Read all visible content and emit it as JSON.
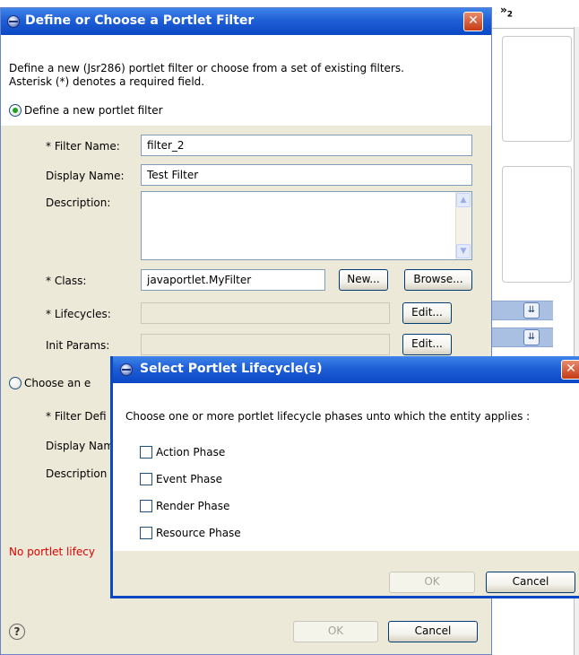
{
  "background": {
    "chevron": "»",
    "chevron_sub": "2",
    "bar_icons": [
      "double-chevron-down-icon",
      "double-chevron-down-icon"
    ]
  },
  "main_dialog": {
    "title": "Define or Choose a Portlet Filter",
    "close_symbol": "✕",
    "description_line1": "Define a new (Jsr286) portlet filter or choose from a set of existing filters.",
    "description_line2": "Asterisk (*) denotes a required field.",
    "define_radio_label": "Define a new portlet filter",
    "fields": {
      "filter_name_label": "* Filter Name:",
      "filter_name_value": "filter_2",
      "display_name_label": "Display Name:",
      "display_name_value": "Test Filter",
      "description_label": "Description:",
      "description_value": "",
      "class_label": "* Class:",
      "class_value": "javaportlet.MyFilter",
      "new_button": "New...",
      "browse_button": "Browse...",
      "lifecycles_label": "* Lifecycles:",
      "lifecycles_value": "",
      "edit_button": "Edit...",
      "init_params_label": "Init Params:",
      "init_params_value": ""
    },
    "choose_radio_label": "Choose an e",
    "existing": {
      "filter_def_label": "* Filter Defi",
      "display_name_label": "Display Nam",
      "description_label": "Description"
    },
    "error_text": "No portlet lifecy",
    "help_symbol": "?",
    "ok_button": "OK",
    "cancel_button": "Cancel"
  },
  "lifecycle_dialog": {
    "title": "Select Portlet Lifecycle(s)",
    "close_symbol": "✕",
    "instruction": "Choose one or more portlet lifecycle phases unto which the entity applies :",
    "phases": [
      {
        "label": "Action Phase",
        "checked": false
      },
      {
        "label": "Event Phase",
        "checked": false
      },
      {
        "label": "Render Phase",
        "checked": false
      },
      {
        "label": "Resource Phase",
        "checked": false
      }
    ],
    "ok_button": "OK",
    "cancel_button": "Cancel"
  }
}
